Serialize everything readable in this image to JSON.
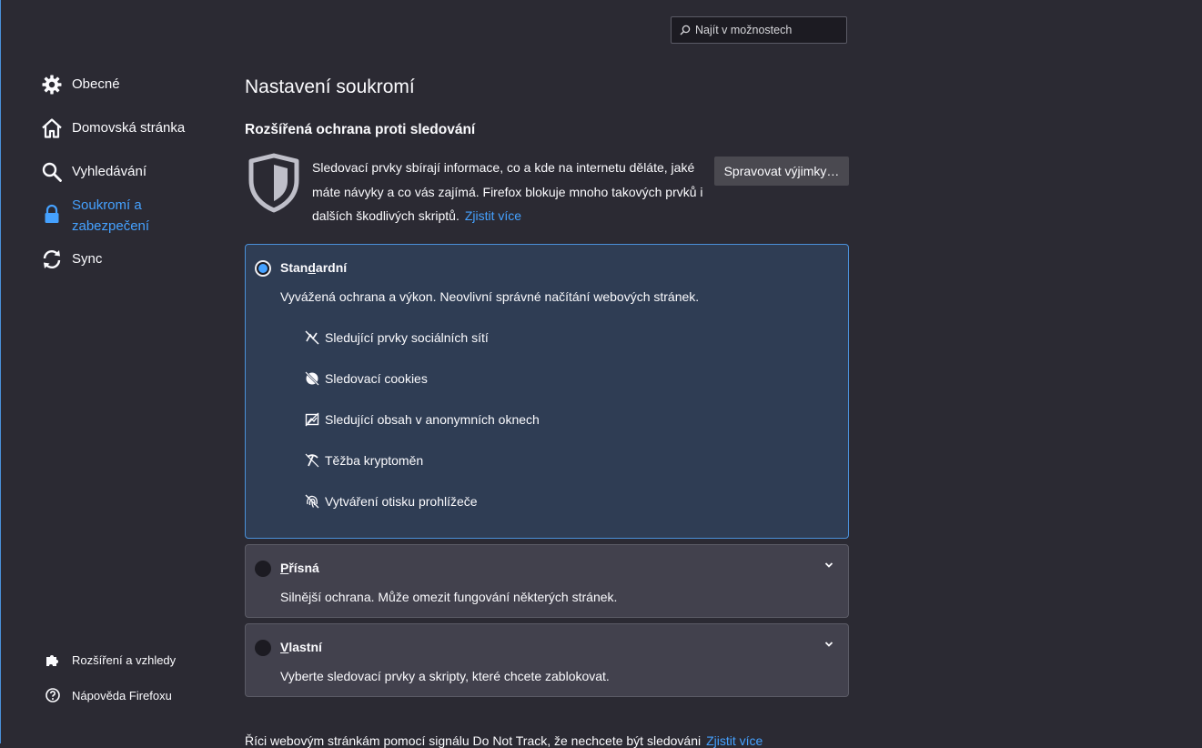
{
  "search": {
    "placeholder": "Najít v možnostech"
  },
  "sidebar": {
    "items": [
      {
        "label": "Obecné",
        "icon": "gear-icon"
      },
      {
        "label": "Domovská stránka",
        "icon": "home-icon"
      },
      {
        "label": "Vyhledávání",
        "icon": "search-icon"
      },
      {
        "label": "Soukromí a zabezpečení",
        "icon": "lock-icon",
        "active": true
      },
      {
        "label": "Sync",
        "icon": "sync-icon"
      }
    ],
    "footer": [
      {
        "label": "Rozšíření a vzhledy",
        "icon": "puzzle-icon"
      },
      {
        "label": "Nápověda Firefoxu",
        "icon": "help-icon"
      }
    ]
  },
  "main": {
    "title": "Nastavení soukromí",
    "etp": {
      "heading": "Rozšířená ochrana proti sledování",
      "description": "Sledovací prvky sbírají informace, co a kde na internetu děláte, jaké máte návyky a co vás zajímá. Firefox blokuje mnoho takových prvků i dalších škodlivých skriptů.",
      "learn_more": "Zjistit více",
      "manage_button": "Spravovat výjimky…",
      "options": [
        {
          "title_pre": "Stan",
          "title_key": "d",
          "title_post": "ardní",
          "description": "Vyvážená ochrana a výkon. Neovlivní správné načítání webových stránek.",
          "selected": true,
          "features": [
            {
              "label": "Sledující prvky sociálních sítí",
              "icon": "social-tracker-icon"
            },
            {
              "label": "Sledovací cookies",
              "icon": "cookie-icon"
            },
            {
              "label": "Sledující obsah v anonymních oknech",
              "icon": "tracking-content-icon"
            },
            {
              "label": "Těžba kryptoměn",
              "icon": "cryptominer-icon"
            },
            {
              "label": "Vytváření otisku prohlížeče",
              "icon": "fingerprint-icon"
            }
          ]
        },
        {
          "title_pre": "",
          "title_key": "P",
          "title_post": "řísná",
          "description": "Silnější ochrana. Může omezit fungování některých stránek.",
          "selected": false
        },
        {
          "title_pre": "",
          "title_key": "V",
          "title_post": "lastní",
          "description": "Vyberte sledovací prvky a skripty, které chcete zablokovat.",
          "selected": false
        }
      ]
    },
    "dnt": {
      "text": "Říci webovým stránkám pomocí signálu Do Not Track, že nechcete být sledováni",
      "learn_more": "Zjistit více"
    }
  },
  "colors": {
    "background": "#2b2a33",
    "accent": "#45a1ff",
    "selected_card": "#2f3d54",
    "card": "#42414d"
  }
}
